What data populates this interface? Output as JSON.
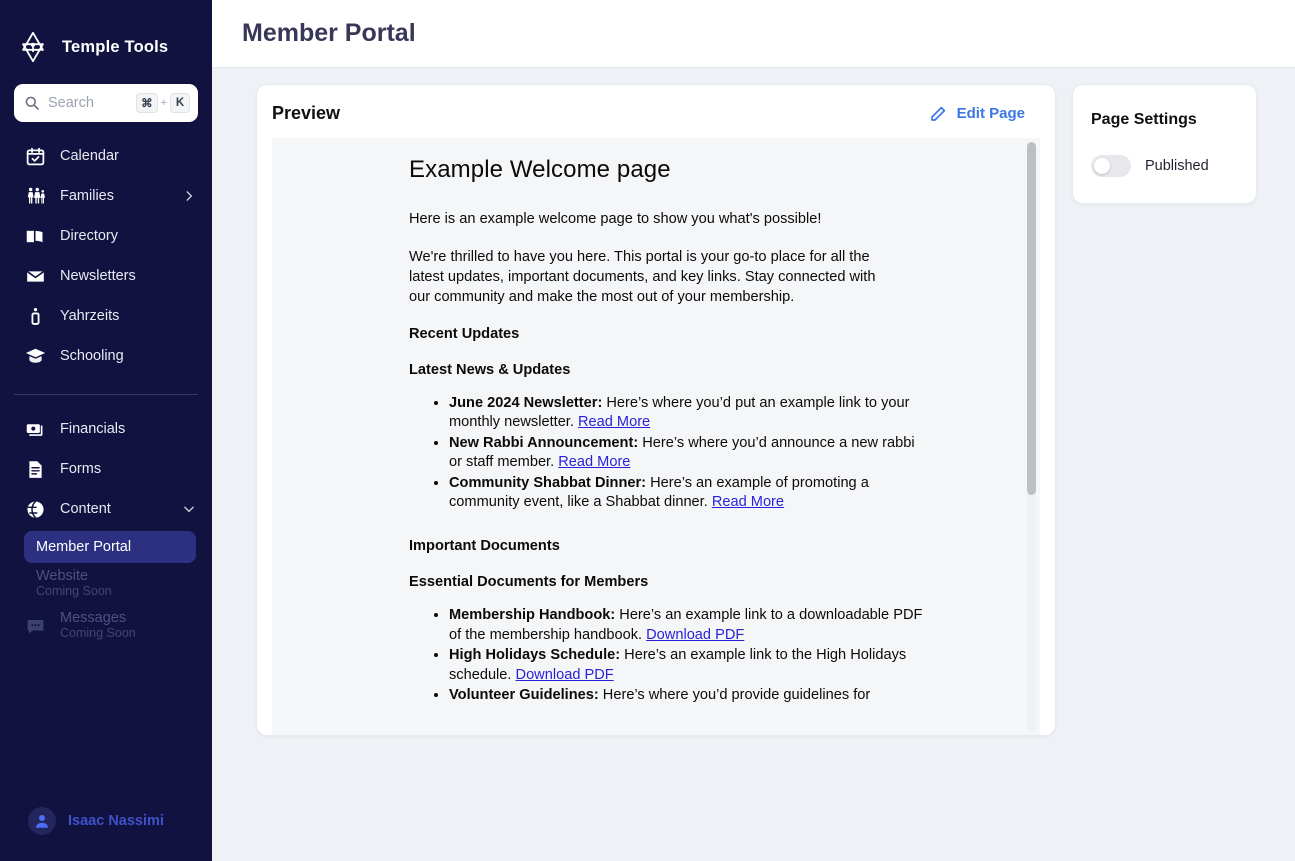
{
  "brand": {
    "name": "Temple Tools",
    "logo_icon": "star-of-david-flame-icon"
  },
  "search": {
    "placeholder": "Search",
    "value": "",
    "icon": "search-icon",
    "kbd_mod": "⌘",
    "kbd_plus": "+",
    "kbd_key": "K"
  },
  "sidebar": {
    "primary_items": [
      {
        "label": "Calendar",
        "icon": "calendar-check-icon"
      },
      {
        "label": "Families",
        "icon": "families-icon",
        "chevron": "chevron-right-icon"
      },
      {
        "label": "Directory",
        "icon": "open-book-icon"
      },
      {
        "label": "Newsletters",
        "icon": "envelope-icon"
      },
      {
        "label": "Yahrzeits",
        "icon": "candle-icon"
      },
      {
        "label": "Schooling",
        "icon": "graduation-cap-icon"
      }
    ],
    "secondary_items": [
      {
        "label": "Financials",
        "icon": "banknote-icon"
      },
      {
        "label": "Forms",
        "icon": "document-icon"
      },
      {
        "label": "Content",
        "icon": "globe-icon",
        "chevron": "chevron-down-icon"
      }
    ],
    "content_children": [
      {
        "label": "Member Portal",
        "active": true
      },
      {
        "label": "Website",
        "sublabel": "Coming Soon",
        "disabled": true
      }
    ],
    "messages_item": {
      "label": "Messages",
      "sublabel": "Coming Soon",
      "icon": "chat-bubble-icon",
      "disabled": true
    },
    "user": {
      "name": "Isaac Nassimi",
      "avatar_icon": "user-avatar-icon"
    }
  },
  "header": {
    "title": "Member Portal"
  },
  "preview": {
    "title": "Preview",
    "edit_label": "Edit Page",
    "edit_icon": "pencil-icon",
    "document": {
      "heading": "Example Welcome page",
      "intro_1": "Here is an example welcome page to show you what's possible!",
      "intro_2": "We're thrilled to have you here. This portal is your go-to place for all the latest updates, important documents, and key links. Stay connected with our community and make the most out of your membership.",
      "section_1_title": "Recent Updates",
      "section_1_subtitle": "Latest News & Updates",
      "news_items": [
        {
          "term": "June 2024 Newsletter:",
          "text": " Here’s where you’d put an example link to your monthly newsletter. ",
          "link": "Read More"
        },
        {
          "term": "New Rabbi Announcement:",
          "text": " Here’s where you’d announce a new rabbi or staff member. ",
          "link": "Read More"
        },
        {
          "term": "Community Shabbat Dinner:",
          "text": " Here’s an example of promoting a community event, like a Shabbat dinner. ",
          "link": "Read More"
        }
      ],
      "section_2_title": "Important Documents",
      "section_2_subtitle": "Essential Documents for Members",
      "doc_items": [
        {
          "term": "Membership Handbook:",
          "text": " Here’s an example link to a downloadable PDF of the membership handbook. ",
          "link": "Download PDF"
        },
        {
          "term": "High Holidays Schedule:",
          "text": " Here’s an example link to the High Holidays schedule. ",
          "link": "Download PDF"
        },
        {
          "term": "Volunteer Guidelines:",
          "text": " Here’s where you’d provide guidelines for",
          "link": ""
        }
      ]
    }
  },
  "page_settings": {
    "title": "Page Settings",
    "published_label": "Published",
    "published_on": false
  },
  "colors": {
    "sidebar_bg": "#121240",
    "active_item": "#2b3180",
    "accent_blue": "#3b76e8",
    "user_name": "#3f51c9",
    "link": "#2b21d8",
    "page_bg": "#eef1f5",
    "title": "#383757"
  }
}
